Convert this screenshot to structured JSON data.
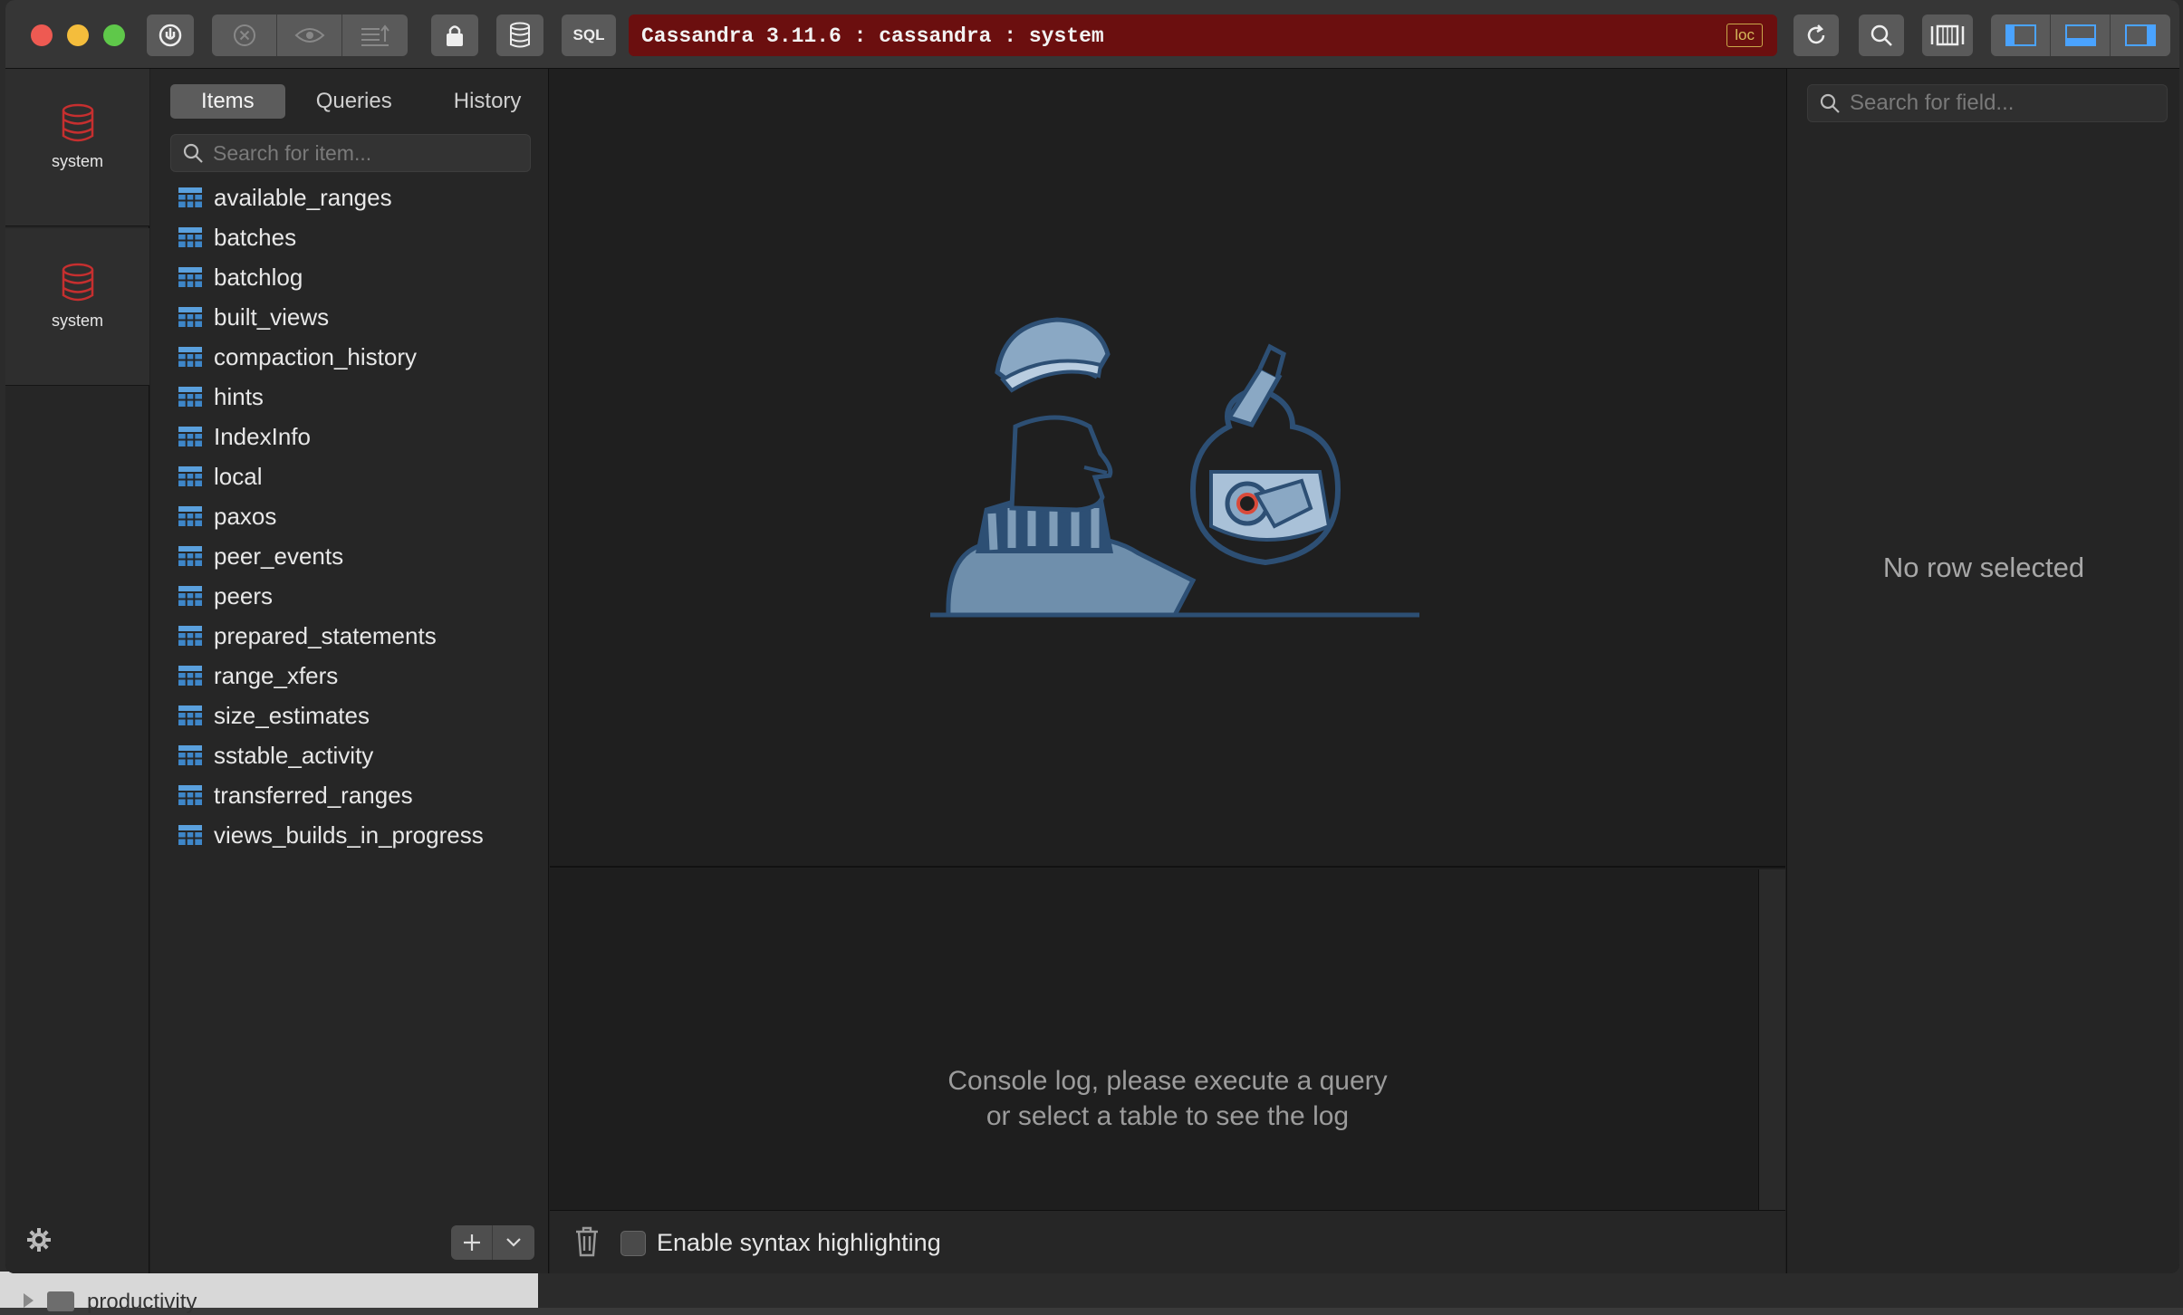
{
  "titlebar": {
    "connection_text": "Cassandra 3.11.6 : cassandra : system",
    "connection_badge": "loc",
    "sql_label": "SQL",
    "connection_color": "#6b0f0f"
  },
  "databases": [
    {
      "label": "system",
      "icon": "database-icon"
    },
    {
      "label": "system",
      "icon": "database-icon"
    }
  ],
  "sidebar": {
    "tabs": [
      {
        "label": "Items",
        "active": true
      },
      {
        "label": "Queries",
        "active": false
      },
      {
        "label": "History",
        "active": false
      }
    ],
    "search_placeholder": "Search for item...",
    "items": [
      "available_ranges",
      "batches",
      "batchlog",
      "built_views",
      "compaction_history",
      "hints",
      "IndexInfo",
      "local",
      "paxos",
      "peer_events",
      "peers",
      "prepared_statements",
      "range_xfers",
      "size_estimates",
      "sstable_activity",
      "transferred_ranges",
      "views_builds_in_progress"
    ]
  },
  "main": {
    "console_message_line1": "Console log, please execute a query",
    "console_message_line2": "or select a table to see the log",
    "syntax_highlight_label": "Enable syntax highlighting"
  },
  "right": {
    "search_placeholder": "Search for field...",
    "empty_message": "No row selected"
  },
  "desktop": {
    "finder_item": "productivity"
  }
}
